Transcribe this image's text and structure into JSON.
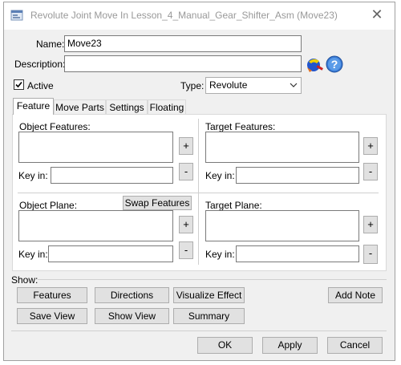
{
  "window": {
    "title": "Revolute Joint Move In Lesson_4_Manual_Gear_Shifter_Asm (Move23)"
  },
  "form": {
    "name_label": "Name:",
    "name_value": "Move23",
    "description_label": "Description:",
    "description_value": "",
    "active_label": "Active",
    "active_checked": true,
    "type_label": "Type:",
    "type_value": "Revolute"
  },
  "tabs": [
    "Feature",
    "Move Parts",
    "Settings",
    "Floating"
  ],
  "feature_panel": {
    "object_features_label": "Object Features:",
    "target_features_label": "Target Features:",
    "keyin_label": "Key in:",
    "object_plane_label": "Object Plane:",
    "target_plane_label": "Target Plane:",
    "swap_button": "Swap Features",
    "plus": "+",
    "minus": "-"
  },
  "show": {
    "label": "Show:",
    "buttons_row1": [
      "Features",
      "Directions",
      "Visualize Effect"
    ],
    "buttons_row2": [
      "Save View",
      "Show View",
      "Summary"
    ],
    "add_note": "Add Note"
  },
  "footer": {
    "ok": "OK",
    "apply": "Apply",
    "cancel": "Cancel"
  },
  "colors": {
    "accent": "#0078d7",
    "button": "#e1e1e1",
    "dialog_bg": "#f0f0f0"
  }
}
